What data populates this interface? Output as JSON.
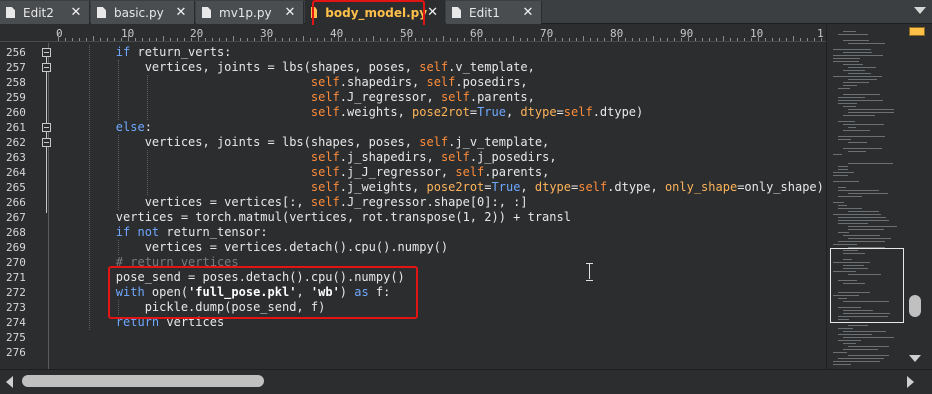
{
  "tabs": [
    {
      "label": "Edit2",
      "icon": "document-icon",
      "active": false
    },
    {
      "label": "basic.py",
      "icon": "document-icon",
      "active": false
    },
    {
      "label": "mv1p.py",
      "icon": "document-icon",
      "active": false
    },
    {
      "label": "body_model.py",
      "icon": "document-icon",
      "active": true
    },
    {
      "label": "Edit1",
      "icon": "document-icon",
      "active": false
    }
  ],
  "tab_close_glyph": "✕",
  "ruler": {
    "numbers": [
      "0",
      "10",
      "20",
      "30",
      "40",
      "50",
      "60",
      "70",
      "80",
      "90",
      "10",
      "1"
    ]
  },
  "line_numbers": [
    "256",
    "257",
    "258",
    "259",
    "260",
    "261",
    "262",
    "263",
    "264",
    "265",
    "266",
    "267",
    "268",
    "269",
    "270",
    "271",
    "272",
    "273",
    "274",
    "275",
    "276"
  ],
  "code_lines": [
    "        if return_verts:",
    "            vertices, joints = lbs(shapes, poses, self.v_template,",
    "                                   self.shapedirs, self.posedirs,",
    "                                   self.J_regressor, self.parents,",
    "                                   self.weights, pose2rot=True, dtype=self.dtype)",
    "        else:",
    "            vertices, joints = lbs(shapes, poses, self.j_v_template,",
    "                                   self.j_shapedirs, self.j_posedirs,",
    "                                   self.j_J_regressor, self.parents,",
    "                                   self.j_weights, pose2rot=True, dtype=self.dtype, only_shape=only_shape)",
    "            vertices = vertices[:, self.J_regressor.shape[0]:, :]",
    "        vertices = torch.matmul(vertices, rot.transpose(1, 2)) + transl",
    "        if not return_tensor:",
    "            vertices = vertices.detach().cpu().numpy()",
    "        # return vertices",
    "        pose_send = poses.detach().cpu().numpy()",
    "        with open('full_pose.pkl', 'wb') as f:",
    "            pickle.dump(pose_send, f)",
    "        return vertices",
    "",
    ""
  ],
  "colors": {
    "background": "#2b2d2f",
    "keyword": "#6fa8ff",
    "self": "#ff8c3a",
    "comment": "#7a7a7a",
    "active_tab_text": "#ffc04a",
    "highlight_box": "#e21414"
  }
}
